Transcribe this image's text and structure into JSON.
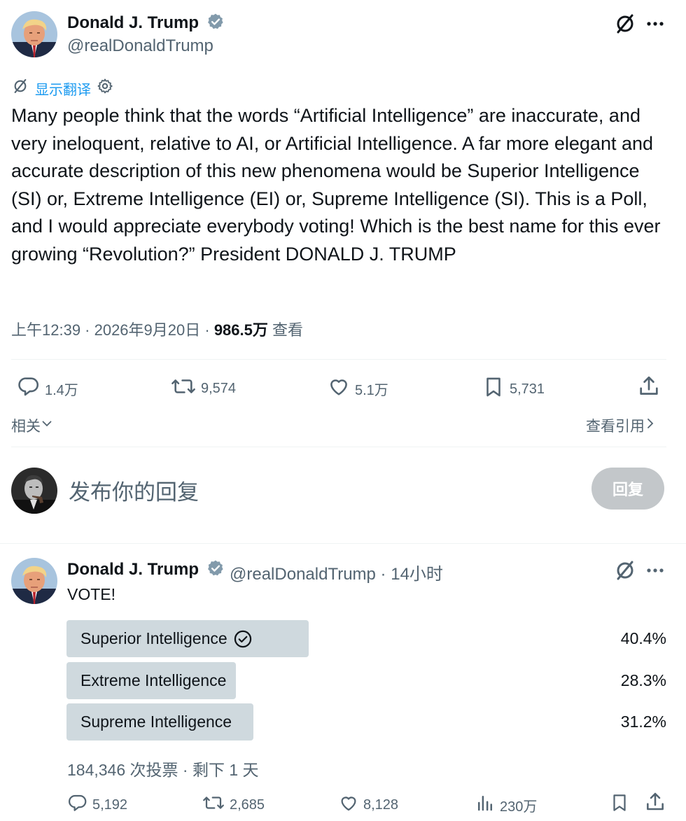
{
  "colors": {
    "accent": "#1d9bf0",
    "text": "#0f1419",
    "muted": "#536471",
    "poll_fill": "#cfd9de",
    "verified": "#829aab"
  },
  "main_tweet": {
    "author_name": "Donald J. Trump",
    "author_handle": "@realDonaldTrump",
    "translate_label": "显示翻译",
    "text": "Many people think that the words “Artificial Intelligence” are inaccurate, and very ineloquent, relative to AI, or Artificial Intelligence. A far more elegant and accurate description of this new phenomena would be Superior Intelligence (SI) or, Extreme Intelligence (EI) or, Supreme Intelligence (SI). This is a Poll, and I would appreciate everybody voting! Which is the best name for this ever growing “Revolution?” President DONALD J. TRUMP",
    "time": "上午12:39 · 2026年9月20日 · ",
    "views": "986.5万",
    "views_label": " 查看",
    "actions": {
      "replies": "1.4万",
      "reposts": "9,574",
      "likes": "5.1万",
      "bookmarks": "5,731"
    },
    "related_label": "相关",
    "quotes_label": "查看引用"
  },
  "reply_box": {
    "placeholder": "发布你的回复",
    "button_label": "回复"
  },
  "reply_tweet": {
    "author_name": "Donald J. Trump",
    "author_handle": "@realDonaldTrump",
    "time": " · 14小时",
    "text": "VOTE!",
    "poll": {
      "options": [
        {
          "label": "Superior Intelligence",
          "percent_text": "40.4%",
          "percent": 40.4,
          "selected": true
        },
        {
          "label": "Extreme Intelligence",
          "percent_text": "28.3%",
          "percent": 28.3,
          "selected": false
        },
        {
          "label": "Supreme Intelligence",
          "percent_text": "31.2%",
          "percent": 31.2,
          "selected": false
        }
      ],
      "summary": "184,346 次投票 · 剩下 1 天"
    },
    "actions": {
      "replies": "5,192",
      "reposts": "2,685",
      "likes": "8,128",
      "views": "230万"
    }
  },
  "icons": [
    "verified-badge-icon",
    "grok-icon",
    "more-icon",
    "translate-icon",
    "gear-icon",
    "reply-icon",
    "repost-icon",
    "like-icon",
    "bookmark-icon",
    "share-icon",
    "chevron-down-icon",
    "chevron-right-icon",
    "views-icon",
    "checkmark-circle-icon"
  ]
}
